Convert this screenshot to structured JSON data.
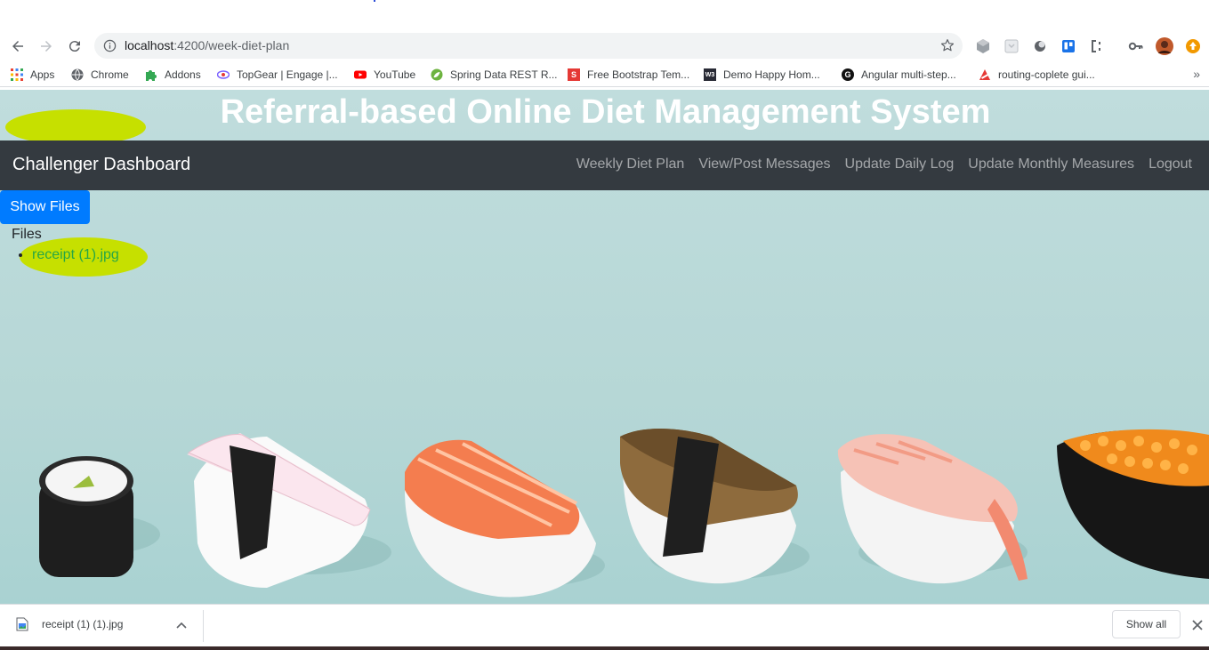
{
  "browser": {
    "url_host": "localhost",
    "url_path": ":4200/week-diet-plan",
    "bookmarks": [
      {
        "label": "Apps",
        "icon": "apps-grid-icon",
        "color": "#ea4335"
      },
      {
        "label": "Chrome",
        "icon": "globe-icon",
        "color": "#5f6368"
      },
      {
        "label": "Addons",
        "icon": "puzzle-icon",
        "color": "#34a853"
      },
      {
        "label": "TopGear | Engage |...",
        "icon": "topgear-icon",
        "color": "#7b61ff"
      },
      {
        "label": "YouTube",
        "icon": "youtube-icon",
        "color": "#ff0000"
      },
      {
        "label": "Spring Data REST R...",
        "icon": "spring-icon",
        "color": "#6db33f"
      },
      {
        "label": "Free Bootstrap Tem...",
        "icon": "s-logo-icon",
        "color": "#e53935"
      },
      {
        "label": "Demo Happy Hom...",
        "icon": "w3schools-icon",
        "color": "#282a35"
      },
      {
        "label": "Angular multi-step...",
        "icon": "g-logo-icon",
        "color": "#111111"
      },
      {
        "label": "routing-coplete gui...",
        "icon": "routing-icon",
        "color": "#e53935"
      }
    ]
  },
  "site": {
    "title": "Referral-based Online Diet Management System",
    "brand": "Challenger Dashboard",
    "nav": [
      "Weekly Diet Plan",
      "View/Post Messages",
      "Update Daily Log",
      "Update Monthly Measures",
      "Logout"
    ],
    "show_files_label": "Show Files",
    "files_label": "Files",
    "files": [
      "receipt (1).jpg"
    ]
  },
  "downloads": {
    "file_name": "receipt (1) (1).jpg",
    "show_all_label": "Show all"
  },
  "colors": {
    "navbar": "#343a40",
    "primary_button": "#007bff",
    "file_link": "#28a745",
    "highlight_marker": "#c6e000",
    "page_background": "#b6d7d6"
  }
}
